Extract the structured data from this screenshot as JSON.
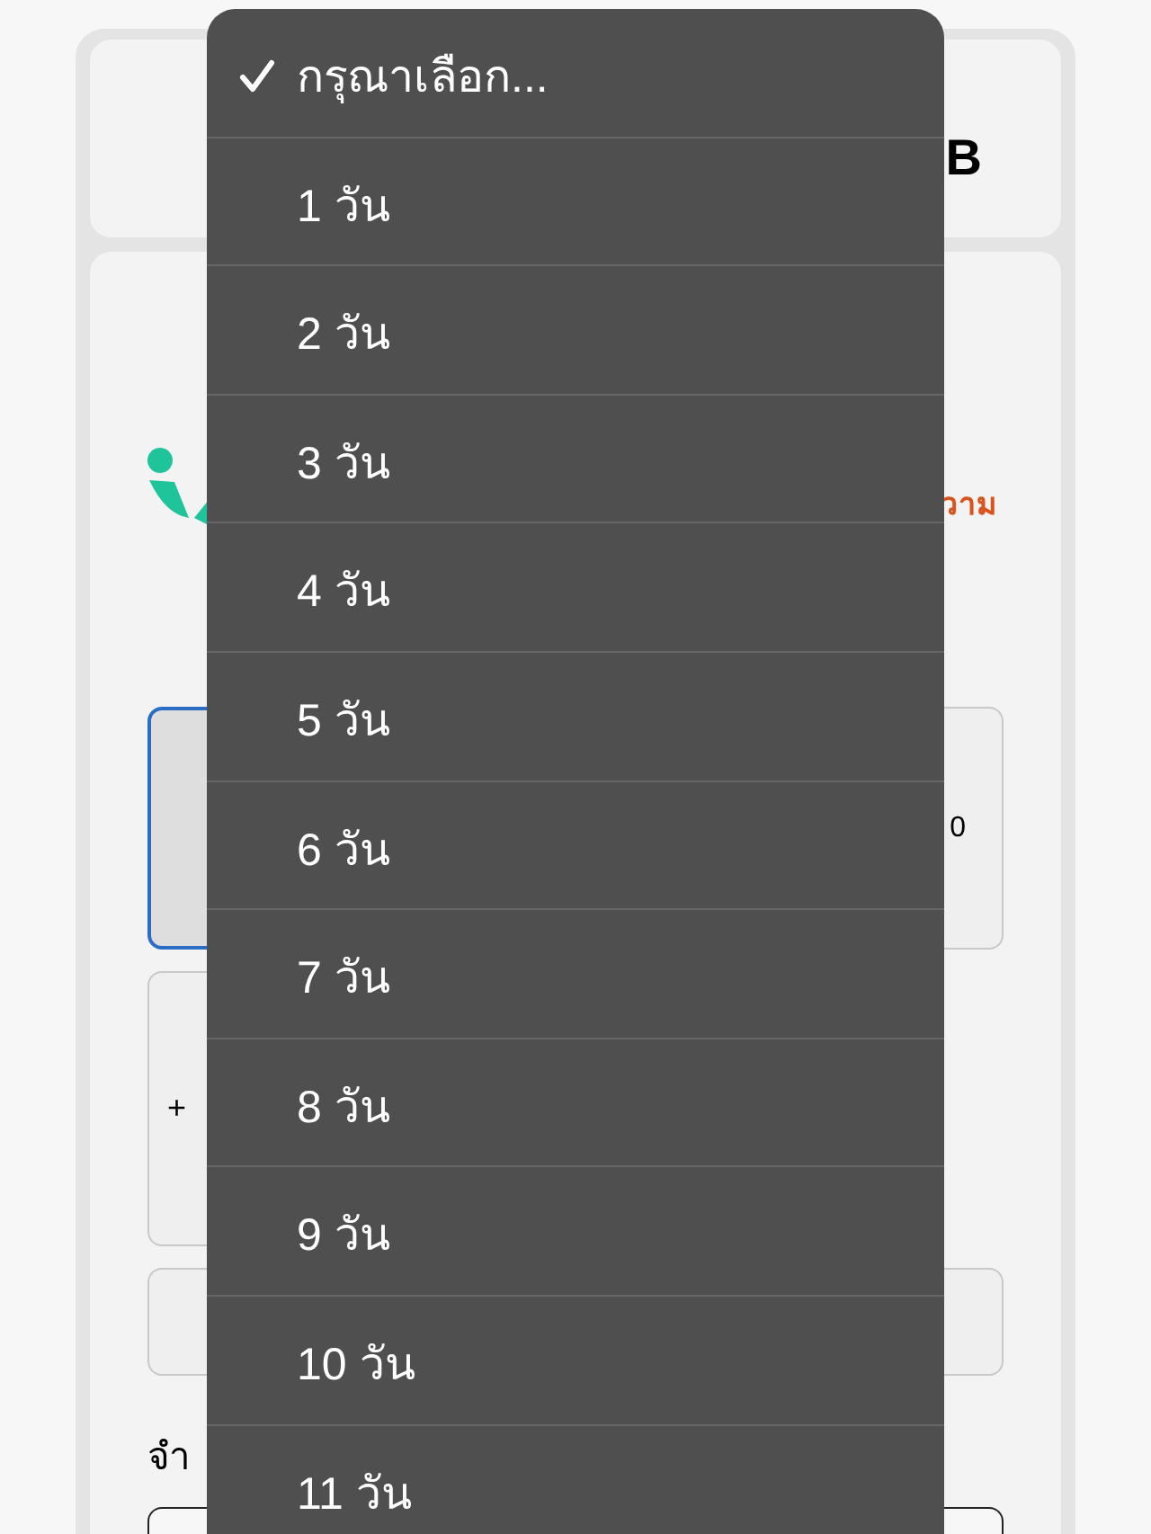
{
  "background": {
    "header": {
      "text": "B"
    },
    "brand": {
      "link": "วาม"
    },
    "option_cards": [
      {
        "selected": true
      },
      {
        "selected": false,
        "text": "0"
      }
    ],
    "add_card": {
      "text": "+"
    },
    "field_label": "จำ"
  },
  "dropdown": {
    "options": [
      {
        "label": "กรุณาเลือก...",
        "selected": true
      },
      {
        "label": "1 วัน",
        "selected": false
      },
      {
        "label": "2 วัน",
        "selected": false
      },
      {
        "label": "3 วัน",
        "selected": false
      },
      {
        "label": "4 วัน",
        "selected": false
      },
      {
        "label": "5 วัน",
        "selected": false
      },
      {
        "label": "6 วัน",
        "selected": false
      },
      {
        "label": "7 วัน",
        "selected": false
      },
      {
        "label": "8 วัน",
        "selected": false
      },
      {
        "label": "9 วัน",
        "selected": false
      },
      {
        "label": "10 วัน",
        "selected": false
      },
      {
        "label": "11 วัน",
        "selected": false
      }
    ]
  }
}
